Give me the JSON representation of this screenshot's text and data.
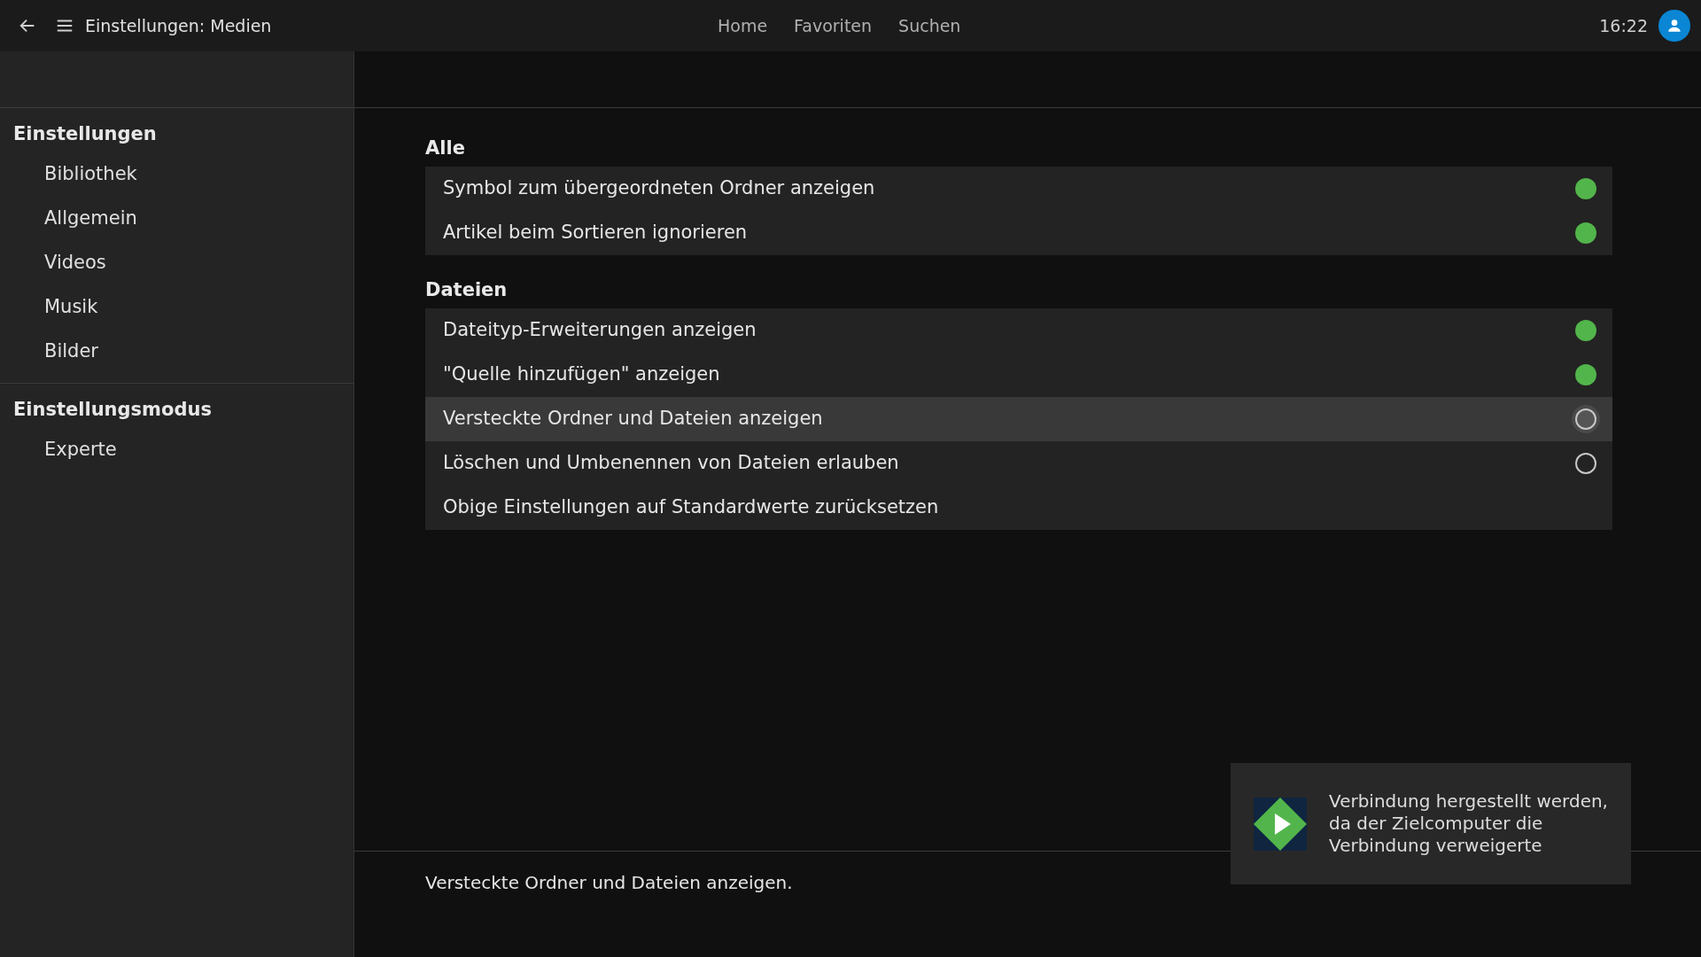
{
  "header": {
    "title": "Einstellungen: Medien",
    "nav": [
      "Home",
      "Favoriten",
      "Suchen"
    ],
    "time": "16:22"
  },
  "sidebar": {
    "groups": [
      {
        "title": "Einstellungen",
        "items": [
          "Bibliothek",
          "Allgemein",
          "Videos",
          "Musik",
          "Bilder"
        ]
      },
      {
        "title": "Einstellungsmodus",
        "items": [
          "Experte"
        ]
      }
    ]
  },
  "sections": [
    {
      "title": "Alle",
      "rows": [
        {
          "label": "Symbol zum übergeordneten Ordner anzeigen",
          "kind": "toggle",
          "on": true,
          "selected": false
        },
        {
          "label": "Artikel beim Sortieren ignorieren",
          "kind": "toggle",
          "on": true,
          "selected": false
        }
      ]
    },
    {
      "title": "Dateien",
      "rows": [
        {
          "label": "Dateityp-Erweiterungen anzeigen",
          "kind": "toggle",
          "on": true,
          "selected": false
        },
        {
          "label": "\"Quelle hinzufügen\" anzeigen",
          "kind": "toggle",
          "on": true,
          "selected": false
        },
        {
          "label": "Versteckte Ordner und Dateien anzeigen",
          "kind": "toggle",
          "on": false,
          "selected": true
        },
        {
          "label": "Löschen und Umbenennen von Dateien erlauben",
          "kind": "toggle",
          "on": false,
          "selected": false
        },
        {
          "label": "Obige Einstellungen auf Standardwerte zurücksetzen",
          "kind": "action",
          "selected": false
        }
      ]
    }
  ],
  "description": "Versteckte Ordner und Dateien anzeigen.",
  "toast": {
    "message": "Verbindung hergestellt werden, da der Zielcomputer die Verbindung verweigerte"
  }
}
